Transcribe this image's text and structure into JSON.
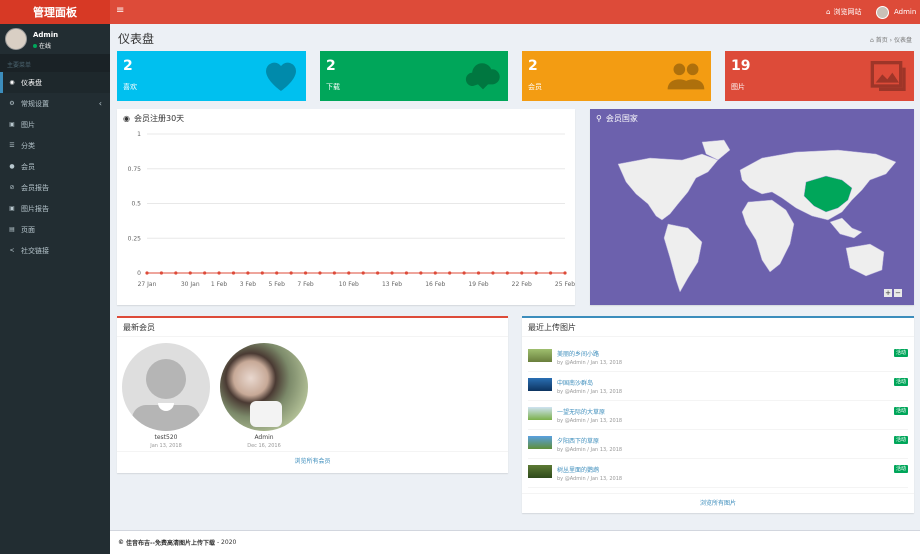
{
  "brand": {
    "logo_text": "管理面板"
  },
  "topbar": {
    "menu_icon": "bars-icon",
    "visit_label": "浏览网站",
    "admin_label": "Admin"
  },
  "sidebar": {
    "user": {
      "name": "Admin",
      "status": "在线"
    },
    "header": "主要菜单",
    "items": [
      {
        "label": "仪表盘",
        "icon": "dashboard-icon",
        "active": true
      },
      {
        "label": "常规设置",
        "icon": "cogs-icon"
      },
      {
        "label": "图片",
        "icon": "image-icon"
      },
      {
        "label": "分类",
        "icon": "list-icon"
      },
      {
        "label": "会员",
        "icon": "user-icon"
      },
      {
        "label": "会员报告",
        "icon": "ban-icon"
      },
      {
        "label": "图片报告",
        "icon": "image-report-icon"
      },
      {
        "label": "页面",
        "icon": "file-icon"
      },
      {
        "label": "社交链接",
        "icon": "share-icon"
      }
    ]
  },
  "page": {
    "title": "仪表盘",
    "breadcrumb_home": "首页",
    "breadcrumb_sep": "›",
    "breadcrumb_current": "仪表盘"
  },
  "stats": [
    {
      "value": "2",
      "label": "喜欢",
      "color": "#00c0ef",
      "icon": "heart-icon"
    },
    {
      "value": "2",
      "label": "下载",
      "color": "#00a65a",
      "icon": "cloud-download-icon"
    },
    {
      "value": "2",
      "label": "会员",
      "color": "#f39c12",
      "icon": "users-icon"
    },
    {
      "value": "19",
      "label": "图片",
      "color": "#dd4b39",
      "icon": "images-icon"
    }
  ],
  "chart_panel": {
    "title": "会员注册30天"
  },
  "chart_data": {
    "type": "line",
    "x": [
      "27 Jan",
      "28 Jan",
      "29 Jan",
      "30 Jan",
      "31 Jan",
      "1 Feb",
      "2 Feb",
      "3 Feb",
      "4 Feb",
      "5 Feb",
      "6 Feb",
      "7 Feb",
      "8 Feb",
      "9 Feb",
      "10 Feb",
      "11 Feb",
      "12 Feb",
      "13 Feb",
      "14 Feb",
      "15 Feb",
      "16 Feb",
      "17 Feb",
      "18 Feb",
      "19 Feb",
      "20 Feb",
      "21 Feb",
      "22 Feb",
      "23 Feb",
      "24 Feb",
      "25 Feb"
    ],
    "values": [
      0,
      0,
      0,
      0,
      0,
      0,
      0,
      0,
      0,
      0,
      0,
      0,
      0,
      0,
      0,
      0,
      0,
      0,
      0,
      0,
      0,
      0,
      0,
      0,
      0,
      0,
      0,
      0,
      0,
      0
    ],
    "x_tick_labels": [
      "27 Jan",
      "30 Jan",
      "1 Feb",
      "3 Feb",
      "5 Feb",
      "7 Feb",
      "10 Feb",
      "13 Feb",
      "16 Feb",
      "19 Feb",
      "22 Feb",
      "25 Feb"
    ],
    "y_ticks": [
      "0",
      "0.25",
      "0.5",
      "0.75",
      "1"
    ],
    "ylim": [
      0,
      1
    ],
    "grid": true,
    "line_color": "#dd4b39"
  },
  "map_panel": {
    "title": "会员国家",
    "zoom_in": "+",
    "zoom_out": "−"
  },
  "members_panel": {
    "title": "最新会员",
    "members": [
      {
        "name": "test520",
        "date": "Jan 13, 2018"
      },
      {
        "name": "Admin",
        "date": "Dec 16, 2016"
      }
    ],
    "footer": "浏览所有会员"
  },
  "photos_panel": {
    "title": "最近上传图片",
    "items": [
      {
        "title": "美丽的乡间小路",
        "meta": "by @Admin / Jan 13, 2018",
        "badge": "活动"
      },
      {
        "title": "中国南沙群岛",
        "meta": "by @Admin / Jan 13, 2018",
        "badge": "活动"
      },
      {
        "title": "一望无际的大草原",
        "meta": "by @Admin / Jan 13, 2018",
        "badge": "活动"
      },
      {
        "title": "夕阳西下的草原",
        "meta": "by @Admin / Jan 13, 2018",
        "badge": "活动"
      },
      {
        "title": "树丛里面的鹦鹉",
        "meta": "by @Admin / Jan 13, 2018",
        "badge": "活动"
      }
    ],
    "footer": "浏览所有图片"
  },
  "footer": {
    "copyright_symbol": "©",
    "site": "佳音布吉--免费高清图片上传下载",
    "year": "- 2020"
  }
}
